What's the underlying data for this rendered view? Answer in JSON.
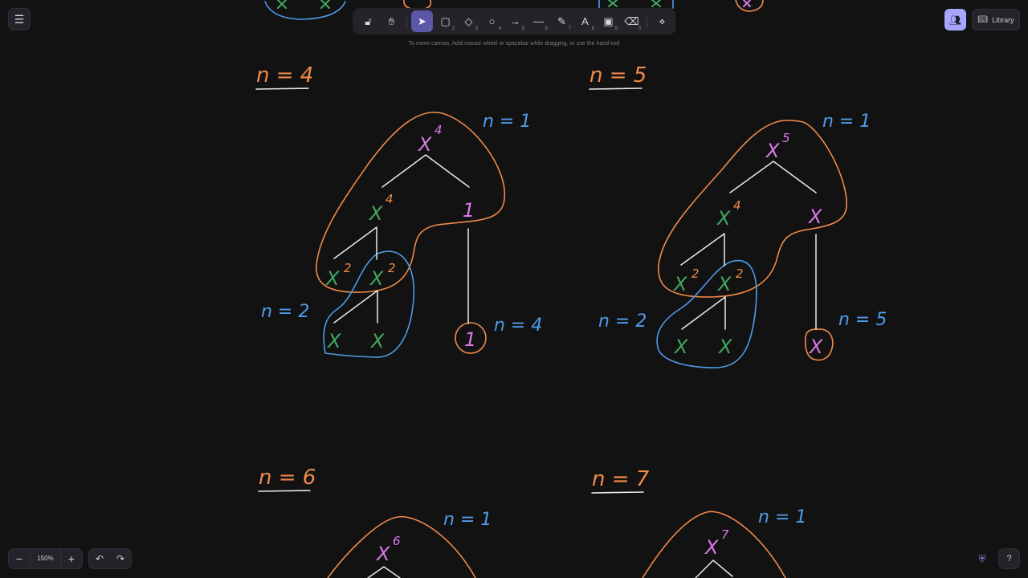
{
  "colors": {
    "background": "#121212",
    "orange": "#f08a4b",
    "blue": "#4f9be8",
    "green": "#40a861",
    "purple": "#d979e8",
    "white": "#e9e9ee",
    "accent": "#a8a5ff"
  },
  "menu": {
    "icon": "hamburger-icon"
  },
  "toolbar": {
    "tools": [
      {
        "name": "lock",
        "icon": "lock-icon",
        "glyph": "🔓︎",
        "key": ""
      },
      {
        "name": "hand",
        "icon": "hand-icon",
        "glyph": "✋︎",
        "key": ""
      },
      {
        "name": "selection",
        "icon": "pointer-icon",
        "glyph": "➤",
        "key": "1",
        "active": true
      },
      {
        "name": "rectangle",
        "icon": "rectangle-icon",
        "glyph": "▢",
        "key": "2"
      },
      {
        "name": "diamond",
        "icon": "diamond-icon",
        "glyph": "◇",
        "key": "3"
      },
      {
        "name": "ellipse",
        "icon": "ellipse-icon",
        "glyph": "○",
        "key": "4"
      },
      {
        "name": "arrow",
        "icon": "arrow-icon",
        "glyph": "→",
        "key": "5"
      },
      {
        "name": "line",
        "icon": "line-icon",
        "glyph": "—",
        "key": "6"
      },
      {
        "name": "draw",
        "icon": "pencil-icon",
        "glyph": "✎",
        "key": "7"
      },
      {
        "name": "text",
        "icon": "text-icon",
        "glyph": "A",
        "key": "8"
      },
      {
        "name": "image",
        "icon": "image-icon",
        "glyph": "▣",
        "key": "9"
      },
      {
        "name": "eraser",
        "icon": "eraser-icon",
        "glyph": "⌫",
        "key": "0"
      },
      {
        "name": "more",
        "icon": "shapes-icon",
        "glyph": "⋄",
        "key": ""
      }
    ]
  },
  "hint": "To move canvas, hold mouse wheel or spacebar while dragging, or use the hand tool",
  "top_right": {
    "library_label": "Library"
  },
  "bottom": {
    "zoom_label": "150%",
    "zoom_out": "−",
    "zoom_in": "+",
    "undo": "↶",
    "redo": "↷",
    "help": "?"
  },
  "canvas_text": {
    "n4": "n = 4",
    "n5": "n = 5",
    "n6": "n = 6",
    "n7": "n = 7",
    "n1": "n = 1",
    "n2": "n = 2",
    "n4b": "n = 4",
    "n5b": "n = 5",
    "x": "X",
    "one": "1",
    "e1": "4",
    "e2": "5",
    "e4": "4",
    "e2b": "2",
    "e6": "6",
    "e7": "7"
  }
}
